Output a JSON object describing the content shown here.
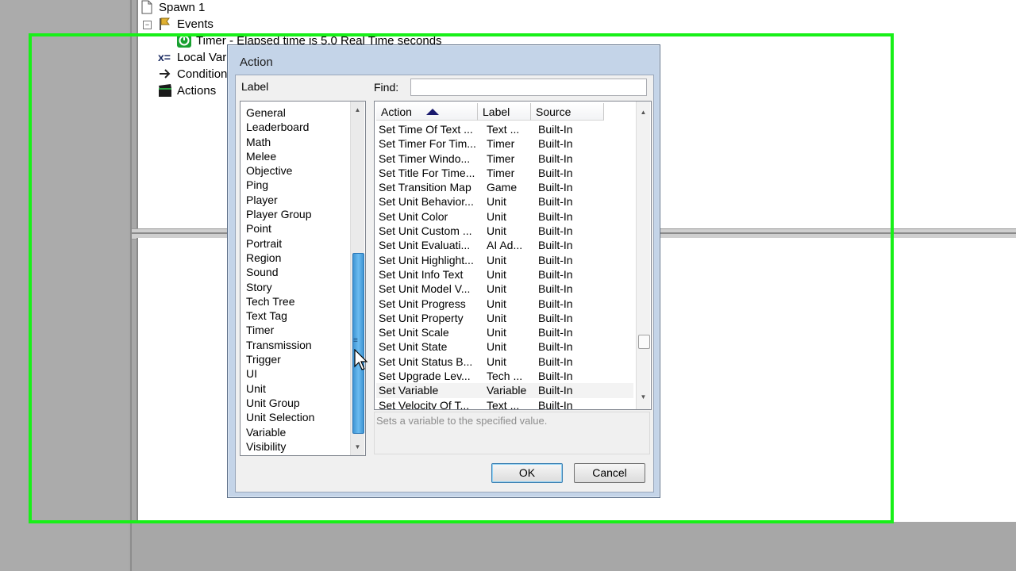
{
  "editor": {
    "tree": {
      "root_label": "Spawn 1",
      "events_label": "Events",
      "timer_event_label": "Timer - Elapsed time is 5.0 Real Time seconds",
      "local_vars_label": "Local Vari",
      "conditions_label": "Conditions",
      "actions_label": "Actions"
    }
  },
  "dialog": {
    "title": "Action",
    "label_header": "Label",
    "find_label": "Find:",
    "find_value": "",
    "categories": [
      "General",
      "Leaderboard",
      "Math",
      "Melee",
      "Objective",
      "Ping",
      "Player",
      "Player Group",
      "Point",
      "Portrait",
      "Region",
      "Sound",
      "Story",
      "Tech Tree",
      "Text Tag",
      "Timer",
      "Transmission",
      "Trigger",
      "UI",
      "Unit",
      "Unit Group",
      "Unit Selection",
      "Variable",
      "Visibility"
    ],
    "columns": {
      "action": "Action",
      "label": "Label",
      "source": "Source"
    },
    "sort_indicator": "sort-ascending-icon",
    "rows": [
      {
        "action": "Set Time Of Text ...",
        "label": "Text ...",
        "source": "Built-In"
      },
      {
        "action": "Set Timer For Tim...",
        "label": "Timer",
        "source": "Built-In"
      },
      {
        "action": "Set Timer Windo...",
        "label": "Timer",
        "source": "Built-In"
      },
      {
        "action": "Set Title For Time...",
        "label": "Timer",
        "source": "Built-In"
      },
      {
        "action": "Set Transition Map",
        "label": "Game",
        "source": "Built-In"
      },
      {
        "action": "Set Unit Behavior...",
        "label": "Unit",
        "source": "Built-In"
      },
      {
        "action": "Set Unit Color",
        "label": "Unit",
        "source": "Built-In"
      },
      {
        "action": "Set Unit Custom ...",
        "label": "Unit",
        "source": "Built-In"
      },
      {
        "action": "Set Unit Evaluati...",
        "label": "AI Ad...",
        "source": "Built-In"
      },
      {
        "action": "Set Unit Highlight...",
        "label": "Unit",
        "source": "Built-In"
      },
      {
        "action": "Set Unit Info Text",
        "label": "Unit",
        "source": "Built-In"
      },
      {
        "action": "Set Unit Model V...",
        "label": "Unit",
        "source": "Built-In"
      },
      {
        "action": "Set Unit Progress",
        "label": "Unit",
        "source": "Built-In"
      },
      {
        "action": "Set Unit Property",
        "label": "Unit",
        "source": "Built-In"
      },
      {
        "action": "Set Unit Scale",
        "label": "Unit",
        "source": "Built-In"
      },
      {
        "action": "Set Unit State",
        "label": "Unit",
        "source": "Built-In"
      },
      {
        "action": "Set Unit Status B...",
        "label": "Unit",
        "source": "Built-In"
      },
      {
        "action": "Set Upgrade Lev...",
        "label": "Tech ...",
        "source": "Built-In"
      },
      {
        "action": "Set Variable",
        "label": "Variable",
        "source": "Built-In"
      },
      {
        "action": "Set Velocity Of T...",
        "label": "Text ...",
        "source": "Built-In"
      }
    ],
    "selected_row": 18,
    "description": "Sets a variable to the specified value.",
    "ok_label": "OK",
    "cancel_label": "Cancel"
  },
  "colors": {
    "highlight_frame": "#18f018",
    "thumb_blue": "#4aa3df",
    "dialog_frame": "#c4d4e8"
  }
}
